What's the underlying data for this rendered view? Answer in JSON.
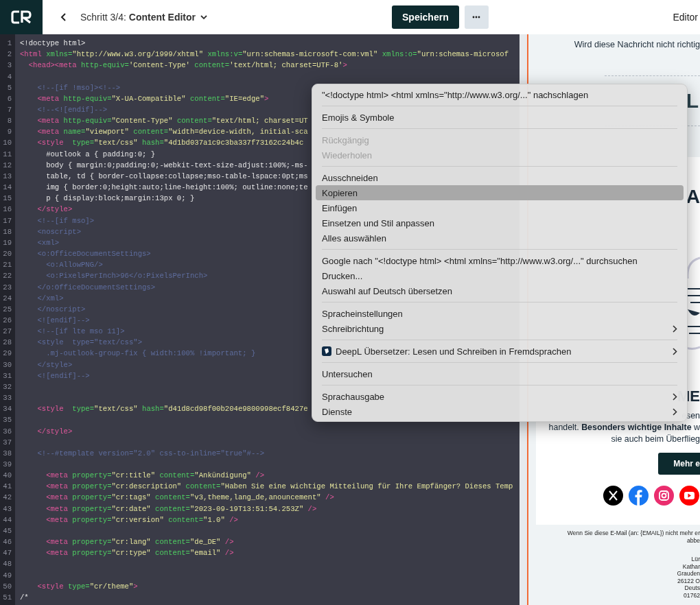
{
  "topbar": {
    "title": "Schritt 3/4: **Content Editor**",
    "save_button": "Speichern",
    "view_label": "Editor"
  },
  "code": [
    {
      "n": "1",
      "tokens": [
        {
          "kind": "plain",
          "text": "<!doctype html>"
        }
      ]
    },
    {
      "n": "2",
      "tokens": [
        {
          "kind": "tag",
          "text": "<html"
        },
        {
          "kind": "attr",
          "text": " xmlns="
        },
        {
          "kind": "str",
          "text": "\"http://www.w3.org/1999/xhtml\""
        },
        {
          "kind": "attr",
          "text": " xmlns:v="
        },
        {
          "kind": "str",
          "text": "\"urn:schemas-microsoft-com:vml\""
        },
        {
          "kind": "attr",
          "text": " xmlns:o="
        },
        {
          "kind": "str",
          "text": "\"urn:schemas-microsof"
        }
      ]
    },
    {
      "n": "3",
      "tokens": [
        {
          "kind": "tag",
          "text": "  <head><meta"
        },
        {
          "kind": "attr",
          "text": " http-equiv="
        },
        {
          "kind": "str",
          "text": "'Content-Type'"
        },
        {
          "kind": "attr",
          "text": " content="
        },
        {
          "kind": "str",
          "text": "'text/html; charset=UTF-8'"
        },
        {
          "kind": "tag",
          "text": ">"
        }
      ]
    },
    {
      "n": "4"
    },
    {
      "n": "5",
      "tokens": [
        {
          "kind": "comment",
          "text": "    <!--[if !mso]><!-->"
        }
      ]
    },
    {
      "n": "6",
      "tokens": [
        {
          "kind": "tag",
          "text": "    <meta"
        },
        {
          "kind": "attr",
          "text": " http-equiv="
        },
        {
          "kind": "str",
          "text": "\"X-UA-Compatible\""
        },
        {
          "kind": "attr",
          "text": " content="
        },
        {
          "kind": "str",
          "text": "\"IE=edge\""
        },
        {
          "kind": "tag",
          "text": ">"
        }
      ]
    },
    {
      "n": "7",
      "tokens": [
        {
          "kind": "comment",
          "text": "    <!--<![endif]-->"
        }
      ]
    },
    {
      "n": "8",
      "tokens": [
        {
          "kind": "tag",
          "text": "    <meta"
        },
        {
          "kind": "attr",
          "text": " http-equiv="
        },
        {
          "kind": "str",
          "text": "\"Content-Type\""
        },
        {
          "kind": "attr",
          "text": " content="
        },
        {
          "kind": "str",
          "text": "\"text/html; charset=UT"
        }
      ]
    },
    {
      "n": "9",
      "tokens": [
        {
          "kind": "tag",
          "text": "    <meta"
        },
        {
          "kind": "attr",
          "text": " name="
        },
        {
          "kind": "str",
          "text": "\"viewport\""
        },
        {
          "kind": "attr",
          "text": " content="
        },
        {
          "kind": "str",
          "text": "\"width=device-width, initial-sca"
        }
      ]
    },
    {
      "n": "10",
      "tokens": [
        {
          "kind": "tag",
          "text": "    <style"
        },
        {
          "kind": "attr",
          "text": "  type="
        },
        {
          "kind": "str",
          "text": "\"text/css\""
        },
        {
          "kind": "attr",
          "text": " hash="
        },
        {
          "kind": "str",
          "text": "\"4d1bd037a1c9c3ba337f73162c24b4c"
        }
      ]
    },
    {
      "n": "11",
      "tokens": [
        {
          "kind": "plain",
          "text": "      #outlook a { padding:0; }"
        }
      ]
    },
    {
      "n": "12",
      "tokens": [
        {
          "kind": "plain",
          "text": "      body { margin:0;padding:0;-webkit-text-size-adjust:100%;-ms-"
        }
      ]
    },
    {
      "n": "13",
      "tokens": [
        {
          "kind": "plain",
          "text": "      table, td { border-collapse:collapse;mso-table-lspace:0pt;ms"
        }
      ]
    },
    {
      "n": "14",
      "tokens": [
        {
          "kind": "plain",
          "text": "      img { border:0;height:auto;line-height:100%; outline:none;te"
        }
      ]
    },
    {
      "n": "15",
      "tokens": [
        {
          "kind": "plain",
          "text": "      p { display:block;margin:13px 0; }"
        }
      ]
    },
    {
      "n": "16",
      "tokens": [
        {
          "kind": "tag",
          "text": "    </style>"
        }
      ]
    },
    {
      "n": "17",
      "tokens": [
        {
          "kind": "comment",
          "text": "    <!--[if mso]>"
        }
      ]
    },
    {
      "n": "18",
      "tokens": [
        {
          "kind": "comment",
          "text": "    <noscript>"
        }
      ]
    },
    {
      "n": "19",
      "tokens": [
        {
          "kind": "comment",
          "text": "    <xml>"
        }
      ]
    },
    {
      "n": "20",
      "tokens": [
        {
          "kind": "comment",
          "text": "    <o:OfficeDocumentSettings>"
        }
      ]
    },
    {
      "n": "21",
      "tokens": [
        {
          "kind": "comment",
          "text": "      <o:AllowPNG/>"
        }
      ]
    },
    {
      "n": "22",
      "tokens": [
        {
          "kind": "comment",
          "text": "      <o:PixelsPerInch>96</o:PixelsPerInch>"
        }
      ]
    },
    {
      "n": "23",
      "tokens": [
        {
          "kind": "comment",
          "text": "    </o:OfficeDocumentSettings>"
        }
      ]
    },
    {
      "n": "24",
      "tokens": [
        {
          "kind": "comment",
          "text": "    </xml>"
        }
      ]
    },
    {
      "n": "25",
      "tokens": [
        {
          "kind": "comment",
          "text": "    </noscript>"
        }
      ]
    },
    {
      "n": "26",
      "tokens": [
        {
          "kind": "comment",
          "text": "    <![endif]-->"
        }
      ]
    },
    {
      "n": "27",
      "tokens": [
        {
          "kind": "comment",
          "text": "    <!--[if lte mso 11]>"
        }
      ]
    },
    {
      "n": "28",
      "tokens": [
        {
          "kind": "comment",
          "text": "    <style  type=\"text/css\">"
        }
      ]
    },
    {
      "n": "29",
      "tokens": [
        {
          "kind": "comment",
          "text": "      .mj-outlook-group-fix { width:100% !important; }"
        }
      ]
    },
    {
      "n": "30",
      "tokens": [
        {
          "kind": "comment",
          "text": "    </style>"
        }
      ]
    },
    {
      "n": "31",
      "tokens": [
        {
          "kind": "comment",
          "text": "    <![endif]-->"
        }
      ]
    },
    {
      "n": "32"
    },
    {
      "n": "33"
    },
    {
      "n": "34",
      "tokens": [
        {
          "kind": "tag",
          "text": "    <style"
        },
        {
          "kind": "attr",
          "text": "  type="
        },
        {
          "kind": "str",
          "text": "\"text/css\""
        },
        {
          "kind": "attr",
          "text": " hash="
        },
        {
          "kind": "str",
          "text": "\"d41d8cd98f00b204e9800998ecf8427e"
        }
      ]
    },
    {
      "n": "35"
    },
    {
      "n": "36",
      "tokens": [
        {
          "kind": "tag",
          "text": "    </style>"
        }
      ]
    },
    {
      "n": "37"
    },
    {
      "n": "38",
      "tokens": [
        {
          "kind": "comment",
          "text": "    <!--#template version=\"2.0\" css-to-inline=\"true\"#-->"
        }
      ]
    },
    {
      "n": "39"
    },
    {
      "n": "40",
      "tokens": [
        {
          "kind": "tag",
          "text": "      <meta"
        },
        {
          "kind": "attr",
          "text": " property="
        },
        {
          "kind": "str",
          "text": "\"cr:title\""
        },
        {
          "kind": "attr",
          "text": " content="
        },
        {
          "kind": "str",
          "text": "\"Ankündigung\""
        },
        {
          "kind": "tag",
          "text": " />"
        }
      ]
    },
    {
      "n": "41",
      "tokens": [
        {
          "kind": "tag",
          "text": "      <meta"
        },
        {
          "kind": "attr",
          "text": " property="
        },
        {
          "kind": "str",
          "text": "\"cr:description\""
        },
        {
          "kind": "attr",
          "text": " content="
        },
        {
          "kind": "str",
          "text": "\"Haben Sie eine wichtige Mitteilung für Ihre Empfänger? Dieses Temp"
        }
      ]
    },
    {
      "n": "42",
      "tokens": [
        {
          "kind": "tag",
          "text": "      <meta"
        },
        {
          "kind": "attr",
          "text": " property="
        },
        {
          "kind": "str",
          "text": "\"cr:tags\""
        },
        {
          "kind": "attr",
          "text": " content="
        },
        {
          "kind": "str",
          "text": "\"v3,theme,lang_de,anouncement\""
        },
        {
          "kind": "tag",
          "text": " />"
        }
      ]
    },
    {
      "n": "43",
      "tokens": [
        {
          "kind": "tag",
          "text": "      <meta"
        },
        {
          "kind": "attr",
          "text": " property="
        },
        {
          "kind": "str",
          "text": "\"cr:date\""
        },
        {
          "kind": "attr",
          "text": " content="
        },
        {
          "kind": "str",
          "text": "\"2023-09-19T13:51:54.253Z\""
        },
        {
          "kind": "tag",
          "text": " />"
        }
      ]
    },
    {
      "n": "44",
      "tokens": [
        {
          "kind": "tag",
          "text": "      <meta"
        },
        {
          "kind": "attr",
          "text": " property="
        },
        {
          "kind": "str",
          "text": "\"cr:version\""
        },
        {
          "kind": "attr",
          "text": " content="
        },
        {
          "kind": "str",
          "text": "\"1.0\""
        },
        {
          "kind": "tag",
          "text": " />"
        }
      ]
    },
    {
      "n": "45"
    },
    {
      "n": "46",
      "tokens": [
        {
          "kind": "tag",
          "text": "      <meta"
        },
        {
          "kind": "attr",
          "text": " property="
        },
        {
          "kind": "str",
          "text": "\"cr:lang\""
        },
        {
          "kind": "attr",
          "text": " content="
        },
        {
          "kind": "str",
          "text": "\"de_DE\""
        },
        {
          "kind": "tag",
          "text": " />"
        }
      ]
    },
    {
      "n": "47",
      "tokens": [
        {
          "kind": "tag",
          "text": "      <meta"
        },
        {
          "kind": "attr",
          "text": " property="
        },
        {
          "kind": "str",
          "text": "\"cr:type\""
        },
        {
          "kind": "attr",
          "text": " content="
        },
        {
          "kind": "str",
          "text": "\"email\""
        },
        {
          "kind": "tag",
          "text": " />"
        }
      ]
    },
    {
      "n": "48"
    },
    {
      "n": "49"
    },
    {
      "n": "50",
      "tokens": [
        {
          "kind": "tag",
          "text": "    <style"
        },
        {
          "kind": "attr",
          "text": " type="
        },
        {
          "kind": "str",
          "text": "\"cr/theme\""
        },
        {
          "kind": "tag",
          "text": ">"
        }
      ]
    },
    {
      "n": "51",
      "tokens": [
        {
          "kind": "plain",
          "text": "/*"
        }
      ]
    }
  ],
  "preview": {
    "preheader": "Wird diese Nachricht nicht richtig",
    "logo_text": "L",
    "headline": "A",
    "subheadline": "ME",
    "body": [
      "esen",
      "handelt. **Besonders wichtige Inhalte** w",
      "sie auch beim Überflieg"
    ],
    "button": "Mehr e",
    "social": [
      {
        "kind": "x"
      },
      {
        "kind": "facebook"
      },
      {
        "kind": "instagram"
      },
      {
        "kind": "youtube"
      }
    ],
    "footer": [
      "Wenn Sie diese E-Mail (an: {EMAIL}) nicht mehr er",
      "abbe"
    ],
    "address": [
      "Lür",
      "Kathar",
      "Grauden",
      "26122 O",
      "Deuts",
      "01762"
    ]
  },
  "context_menu": [
    [
      {
        "label": "\"<!doctype html> <html xmlns=\"http://www.w3.org/...\" nachschlagen",
        "kind": "action",
        "disabled": false,
        "selected": false,
        "submenu": false
      }
    ],
    [
      {
        "label": "Emojis & Symbole",
        "kind": "action",
        "disabled": false,
        "selected": false,
        "submenu": false
      }
    ],
    [
      {
        "label": "Rückgängig",
        "kind": "action",
        "disabled": true,
        "selected": false,
        "submenu": false
      },
      {
        "label": "Wiederholen",
        "kind": "action",
        "disabled": true,
        "selected": false,
        "submenu": false
      }
    ],
    [
      {
        "label": "Ausschneiden",
        "kind": "action",
        "disabled": false,
        "selected": false,
        "submenu": false
      },
      {
        "label": "Kopieren",
        "kind": "action",
        "disabled": false,
        "selected": true,
        "submenu": false
      },
      {
        "label": "Einfügen",
        "kind": "action",
        "disabled": false,
        "selected": false,
        "submenu": false
      },
      {
        "label": "Einsetzen und Stil anpassen",
        "kind": "action",
        "disabled": false,
        "selected": false,
        "submenu": false
      },
      {
        "label": "Alles auswählen",
        "kind": "action",
        "disabled": false,
        "selected": false,
        "submenu": false
      }
    ],
    [
      {
        "label": "Google nach \"<!doctype html> <html xmlns=\"http://www.w3.org/...\" durchsuchen",
        "kind": "action",
        "disabled": false,
        "selected": false,
        "submenu": false
      },
      {
        "label": "Drucken...",
        "kind": "action",
        "disabled": false,
        "selected": false,
        "submenu": false
      },
      {
        "label": "Auswahl auf Deutsch übersetzen",
        "kind": "action",
        "disabled": false,
        "selected": false,
        "submenu": false
      }
    ],
    [
      {
        "label": "Spracheinstellungen",
        "kind": "action",
        "disabled": false,
        "selected": false,
        "submenu": false
      },
      {
        "label": "Schreibrichtung",
        "kind": "action",
        "disabled": false,
        "selected": false,
        "submenu": true
      }
    ],
    [
      {
        "label": "DeepL Übersetzer: Lesen und Schreiben in Fremdsprachen",
        "kind": "extension",
        "disabled": false,
        "selected": false,
        "submenu": true
      }
    ],
    [
      {
        "label": "Untersuchen",
        "kind": "action",
        "disabled": false,
        "selected": false,
        "submenu": false
      }
    ],
    [
      {
        "label": "Sprachausgabe",
        "kind": "action",
        "disabled": false,
        "selected": false,
        "submenu": true
      },
      {
        "label": "Dienste",
        "kind": "action",
        "disabled": false,
        "selected": false,
        "submenu": true
      }
    ]
  ]
}
